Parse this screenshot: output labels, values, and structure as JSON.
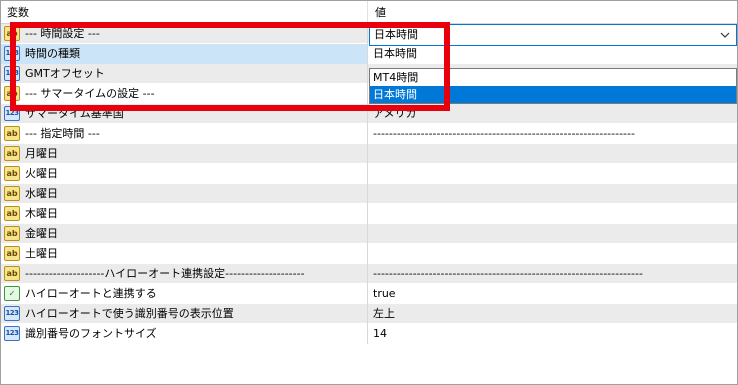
{
  "header": {
    "name_col": "変数",
    "value_col": "値"
  },
  "rows": [
    {
      "icon": "ab-string-icon",
      "name": "--- 時間設定 ---",
      "value": "------------------------------------------------------------------"
    },
    {
      "icon": "123-integer-icon",
      "name": "時間の種類",
      "value": "日本時間"
    },
    {
      "icon": "123-integer-icon",
      "name": "GMTオフセット",
      "value": ""
    },
    {
      "icon": "ab-string-icon",
      "name": "--- サマータイムの設定 ---",
      "value": ""
    },
    {
      "icon": "123-integer-icon",
      "name": "サマータイム基準国",
      "value": "アメリカ"
    },
    {
      "icon": "ab-string-icon",
      "name": "--- 指定時間 ---",
      "value": "------------------------------------------------------------------"
    },
    {
      "icon": "ab-string-icon",
      "name": "月曜日",
      "value": ""
    },
    {
      "icon": "ab-string-icon",
      "name": "火曜日",
      "value": ""
    },
    {
      "icon": "ab-string-icon",
      "name": "水曜日",
      "value": ""
    },
    {
      "icon": "ab-string-icon",
      "name": "木曜日",
      "value": ""
    },
    {
      "icon": "ab-string-icon",
      "name": "金曜日",
      "value": ""
    },
    {
      "icon": "ab-string-icon",
      "name": "土曜日",
      "value": ""
    },
    {
      "icon": "ab-string-icon",
      "name": "--------------------ハイローオート連携設定--------------------",
      "value": "--------------------------------------------------------------------"
    },
    {
      "icon": "bool-check-icon",
      "name": "ハイローオートと連携する",
      "value": "true"
    },
    {
      "icon": "123-integer-icon",
      "name": "ハイローオートで使う識別番号の表示位置",
      "value": "左上"
    },
    {
      "icon": "123-integer-icon",
      "name": "識別番号のフォントサイズ",
      "value": "14"
    }
  ],
  "icons": {
    "ab": "ab",
    "num": "123",
    "bool": "✓"
  },
  "combo": {
    "selected": "日本時間",
    "options": [
      "MT4時間",
      "日本時間"
    ]
  },
  "colors": {
    "accent": "#0078d7",
    "highlight_box": "#e8000c",
    "selected_row": "#cce4f7"
  }
}
